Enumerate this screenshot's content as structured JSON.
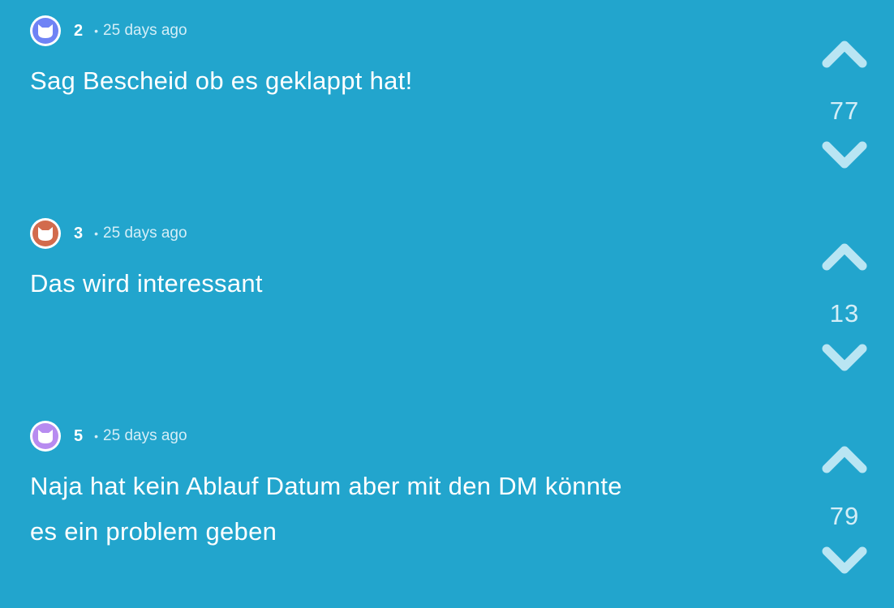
{
  "colors": {
    "background": "#22a5cd",
    "secondary_text": "#d4eef7",
    "vote_arrow": "#b9e5f3"
  },
  "comments": [
    {
      "user_number": "2",
      "separator": "•",
      "time": "25 days ago",
      "avatar_color": "#6f83f5",
      "avatar_icon": "cat-icon",
      "lines": [
        "Sag Bescheid ob es geklappt hat!"
      ],
      "votes": "77"
    },
    {
      "user_number": "3",
      "separator": "•",
      "time": "25 days ago",
      "avatar_color": "#d26b4d",
      "avatar_icon": "cat-icon",
      "lines": [
        "Das wird interessant"
      ],
      "votes": "13"
    },
    {
      "user_number": "5",
      "separator": "•",
      "time": "25 days ago",
      "avatar_color": "#b78bf0",
      "avatar_icon": "cat-icon",
      "lines": [
        "Naja hat kein Ablauf Datum aber mit den DM könnte",
        "es ein problem geben"
      ],
      "votes": "79"
    }
  ]
}
